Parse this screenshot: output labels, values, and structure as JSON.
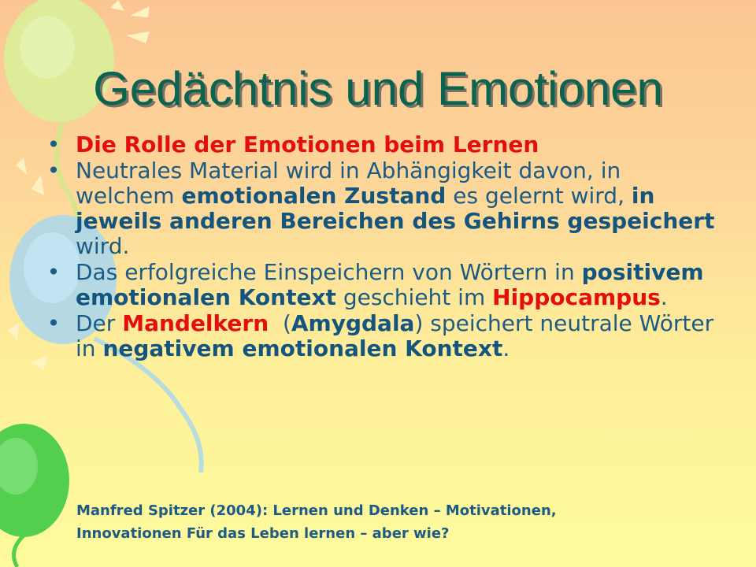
{
  "slide": {
    "title": "Gedächtnis und Emotionen",
    "bullet_glyph": "•",
    "bullet1": {
      "text": "Die Rolle der Emotionen beim Lernen"
    },
    "bullet2": {
      "t1": "Neutrales Material wird in Abhängigkeit davon, in welchem ",
      "b1": "emotionalen Zustand",
      "t2": " es gelernt wird, ",
      "b2": "in jeweils anderen Bereichen des Gehirns gespeichert",
      "t3": " wird."
    },
    "bullet3": {
      "t1": "Das erfolgreiche Einspeichern von Wörtern in ",
      "b1": "positivem emotionalen Kontext",
      "t2": " geschieht im ",
      "r1": "Hippocampus",
      "t3": "."
    },
    "bullet4": {
      "t1": "Der ",
      "r1": "Mandelkern",
      "t2": "  (",
      "b1": "Amygdala",
      "t3": ") speichert neutrale Wörter in ",
      "b2": "negativem emotionalen Kontext",
      "t4": "."
    },
    "citation": {
      "line1": "Manfred Spitzer (2004): Lernen und Denken – Motivationen,",
      "line2": "Innovationen Für das Leben lernen – aber wie?"
    }
  },
  "colors": {
    "title": "#0a6450",
    "body_text": "#1b5b86",
    "highlight_red": "#e40e0e",
    "background_top": "#fbc593",
    "background_bottom": "#fefb9c"
  }
}
